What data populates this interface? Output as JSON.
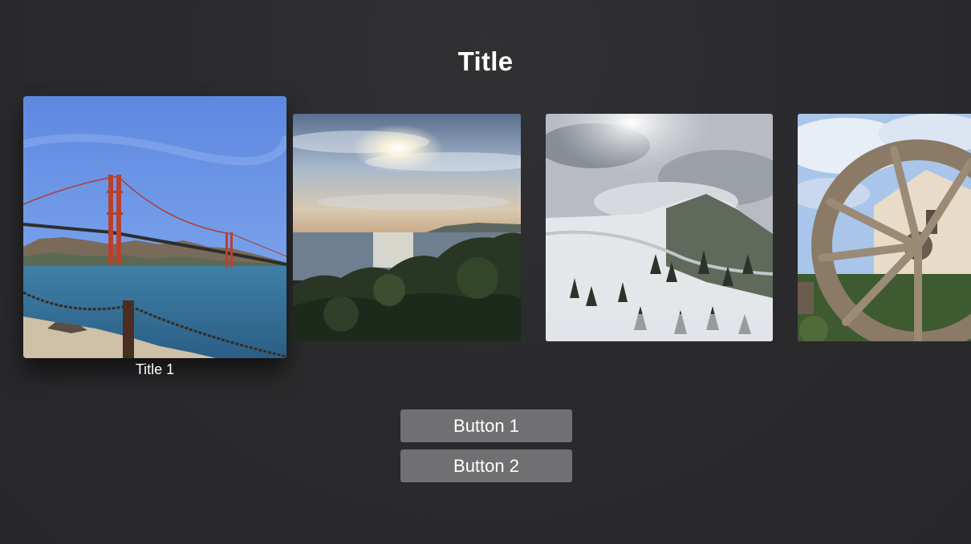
{
  "header": {
    "title": "Title"
  },
  "carousel": {
    "items": [
      {
        "title": "Title 1",
        "image": "golden-gate-bridge",
        "focused": true
      },
      {
        "title": "",
        "image": "ocean-sunset",
        "focused": false
      },
      {
        "title": "",
        "image": "snowy-mountain",
        "focused": false
      },
      {
        "title": "",
        "image": "water-wheel",
        "focused": false
      }
    ]
  },
  "buttons": {
    "button1_label": "Button 1",
    "button2_label": "Button 2"
  },
  "colors": {
    "background": "#2a2a2c",
    "button": "#707073",
    "text": "#ffffff"
  }
}
